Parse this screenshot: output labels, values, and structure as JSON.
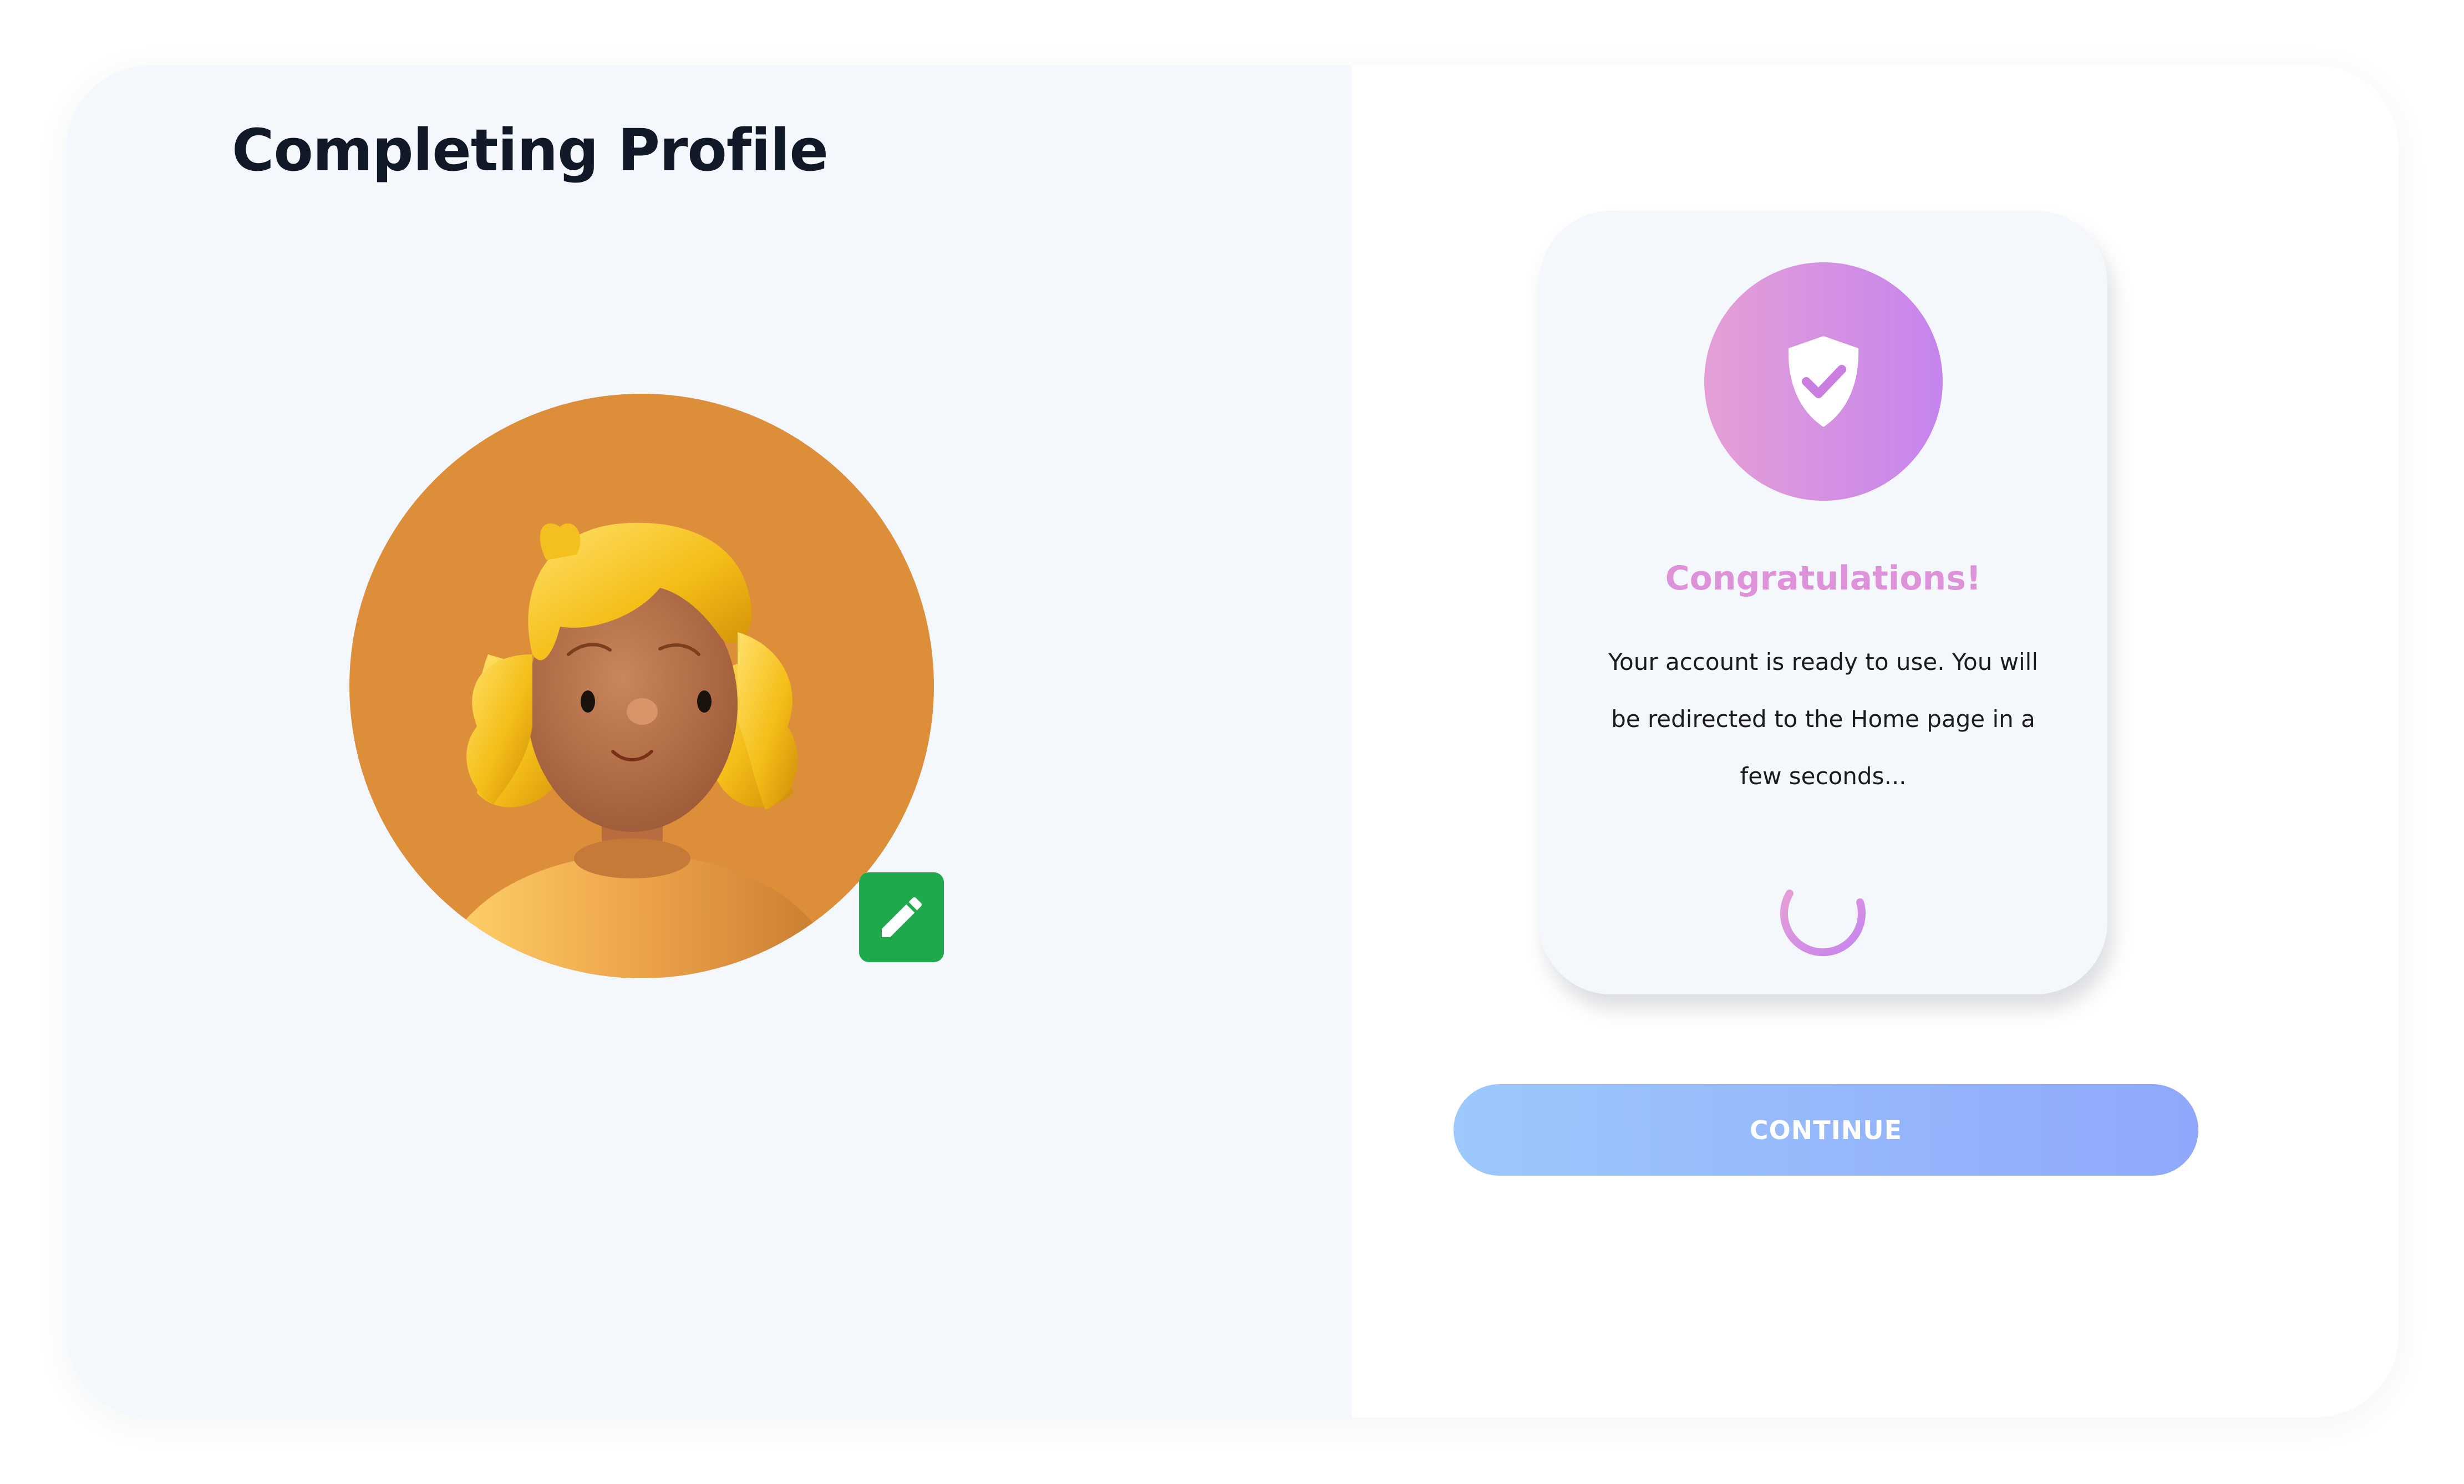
{
  "page": {
    "title": "Completing Profile"
  },
  "avatar": {
    "description_icon": "user-avatar-3d",
    "background_color": "#dc8e39",
    "edit_icon": "pencil-icon",
    "edit_button_color": "#1fa94c"
  },
  "success_card": {
    "icon": "shield-check-icon",
    "heading": "Congratulations!",
    "message_lines": [
      "Your account is ready to use. You will",
      "be redirected to the Home page in a",
      "few seconds..."
    ],
    "loading_icon": "spinner-icon"
  },
  "actions": {
    "continue_label": "CONTINUE"
  },
  "colors": {
    "accent_pink": "#de92da",
    "accent_purple": "#c584ee",
    "button_start": "#9cc8fc",
    "button_end": "#8fa8fb",
    "panel_background": "#f4f8fd",
    "title_color": "#111827"
  }
}
